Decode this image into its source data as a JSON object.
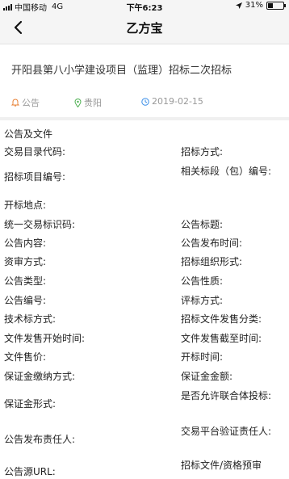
{
  "status_bar": {
    "carrier": "中国移动",
    "network": "4G",
    "time": "下午6:23",
    "battery": "31%",
    "battery_level": 0.31
  },
  "nav": {
    "title": "乙方宝",
    "back_icon": "chevron-left-icon"
  },
  "notice": {
    "title": "开阳县第八小学建设项目（监理）招标二次招标",
    "type": "公告",
    "location": "贵阳",
    "date": "2019-02-15"
  },
  "section": {
    "title": "公告及文件"
  },
  "fields": {
    "left": [
      "交易目录代码:",
      "招标项目编号:",
      "开标地点:",
      "统一交易标识码:",
      "公告内容:",
      "资审方式:",
      "公告类型:",
      "公告编号:",
      "技术标方式:",
      "文件发售开始时间:",
      "文件售价:",
      "保证金缴纳方式:",
      "保证金形式:",
      "公告发布责任人:",
      "公告源URL:"
    ],
    "right": [
      "招标方式:",
      "相关标段（包）编号:",
      "公告标题:",
      "公告发布时间:",
      "招标组织形式:",
      "公告性质:",
      "评标方式:",
      "招标文件发售分类:",
      "文件发售截至时间:",
      "开标时间:",
      "保证金金额:",
      "是否允许联合体投标:",
      "交易平台验证责任人:",
      "招标文件/资格预审"
    ]
  },
  "colors": {
    "bar_bg": "#f5f5f5",
    "divider": "#f0f0f0",
    "notice_icon": "#e8843a",
    "location_icon": "#4caf50",
    "date_icon": "#3a8ee8",
    "meta_text": "#999999"
  }
}
